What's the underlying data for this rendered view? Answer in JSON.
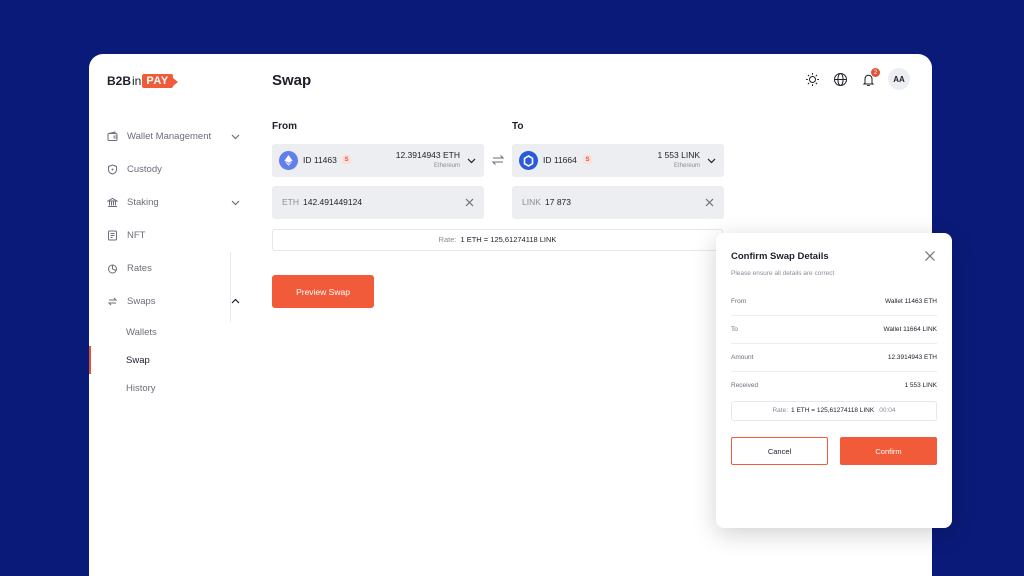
{
  "logo": {
    "part1": "B2B",
    "part2": "in",
    "part3": "PAY"
  },
  "sidebar": {
    "items": [
      {
        "label": "Wallet Management"
      },
      {
        "label": "Custody"
      },
      {
        "label": "Staking"
      },
      {
        "label": "NFT"
      },
      {
        "label": "Rates"
      },
      {
        "label": "Swaps"
      }
    ],
    "sub_items": [
      {
        "label": "Wallets"
      },
      {
        "label": "Swap"
      },
      {
        "label": "History"
      }
    ]
  },
  "header": {
    "title": "Swap",
    "notification_count": "2",
    "avatar_initials": "AA"
  },
  "from": {
    "label": "From",
    "wallet_id": "ID 11463",
    "tag": "S",
    "amount": "12.3914943 ETH",
    "network": "Ethereum",
    "currency": "ETH",
    "input_value": "142.491449124"
  },
  "to": {
    "label": "To",
    "wallet_id": "ID 11664",
    "tag": "S",
    "amount": "1 553 LINK",
    "network": "Ethereum",
    "currency": "LINK",
    "input_value": "17 873"
  },
  "rate": {
    "label": "Rate:",
    "value": "1 ETH = 125,61274118 LINK"
  },
  "preview_button": "Preview Swap",
  "modal": {
    "title": "Confirm Swap Details",
    "subtitle": "Please ensure all details are correct",
    "rows": [
      {
        "key": "From",
        "value": "Wallet 11463 ETH"
      },
      {
        "key": "To",
        "value": "Wallet 11664 LINK"
      },
      {
        "key": "Amount",
        "value": "12.3914943 ETH"
      },
      {
        "key": "Received",
        "value": "1 553 LINK"
      }
    ],
    "rate_label": "Rate:",
    "rate_value": "1 ETH = 125,61274118 LINK",
    "timer": "00:04",
    "cancel_label": "Cancel",
    "confirm_label": "Confirm"
  },
  "colors": {
    "accent": "#f25b3a",
    "background": "#0a1a78"
  }
}
